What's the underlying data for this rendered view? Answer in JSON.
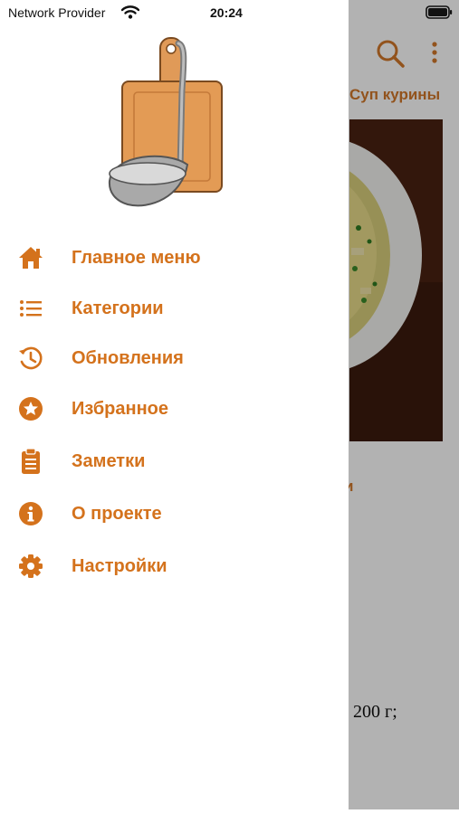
{
  "status_bar": {
    "carrier": "Network Provider",
    "time": "20:24"
  },
  "background_screen": {
    "recipe_title": "Суп курины",
    "section_heading_fragment": "и",
    "ingredient_line": "200 г;"
  },
  "drawer": {
    "menu": [
      {
        "label": "Главное меню",
        "icon": "home-icon"
      },
      {
        "label": "Категории",
        "icon": "list-icon"
      },
      {
        "label": "Обновления",
        "icon": "history-icon"
      },
      {
        "label": "Избранное",
        "icon": "star-icon"
      },
      {
        "label": "Заметки",
        "icon": "clipboard-icon"
      },
      {
        "label": "О проекте",
        "icon": "info-icon"
      },
      {
        "label": "Настройки",
        "icon": "gear-icon"
      }
    ]
  },
  "colors": {
    "accent": "#d4721c",
    "scrim": "rgba(0,0,0,0.30)",
    "drawer_background": "#ffffff"
  }
}
